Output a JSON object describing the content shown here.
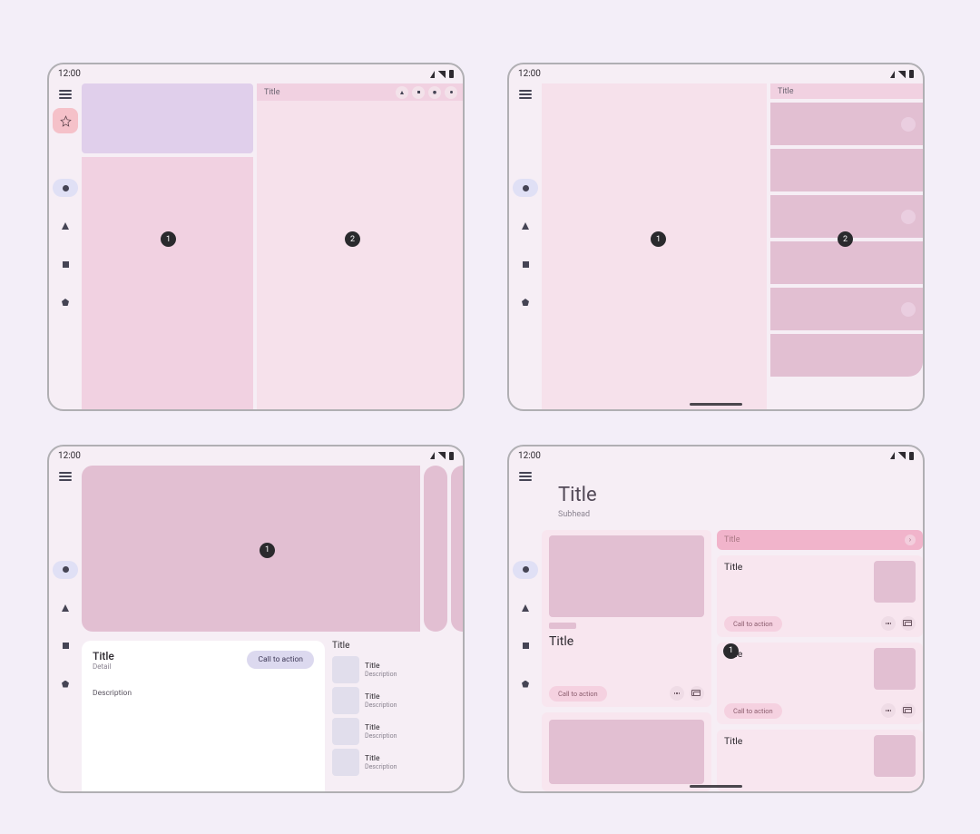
{
  "status": {
    "time": "12:00"
  },
  "panel1": {
    "badges": {
      "left": "1",
      "right": "2"
    },
    "rightTitle": "Title"
  },
  "panel2": {
    "badges": {
      "left": "1",
      "right": "2"
    },
    "rightTitle": "Title"
  },
  "panel3": {
    "badge": "1",
    "card": {
      "title": "Title",
      "detail": "Detail",
      "cta": "Call to action",
      "description": "Description"
    },
    "side": {
      "heading": "Title",
      "items": [
        {
          "title": "Title",
          "detail": "Description"
        },
        {
          "title": "Title",
          "detail": "Description"
        },
        {
          "title": "Title",
          "detail": "Description"
        },
        {
          "title": "Title",
          "detail": "Description"
        }
      ]
    }
  },
  "panel4": {
    "header": {
      "title": "Title",
      "sub": "Subhead"
    },
    "badge": "1",
    "accent": {
      "title": "Title"
    },
    "colA": {
      "card1": {
        "title": "Title",
        "cta": "Call to action"
      },
      "card2": {
        "title": ""
      }
    },
    "colB": {
      "card1": {
        "title": "Title",
        "cta": "Call to action"
      },
      "card2": {
        "title": "Title",
        "cta": "Call to action"
      },
      "card3": {
        "title": "Title"
      }
    }
  }
}
